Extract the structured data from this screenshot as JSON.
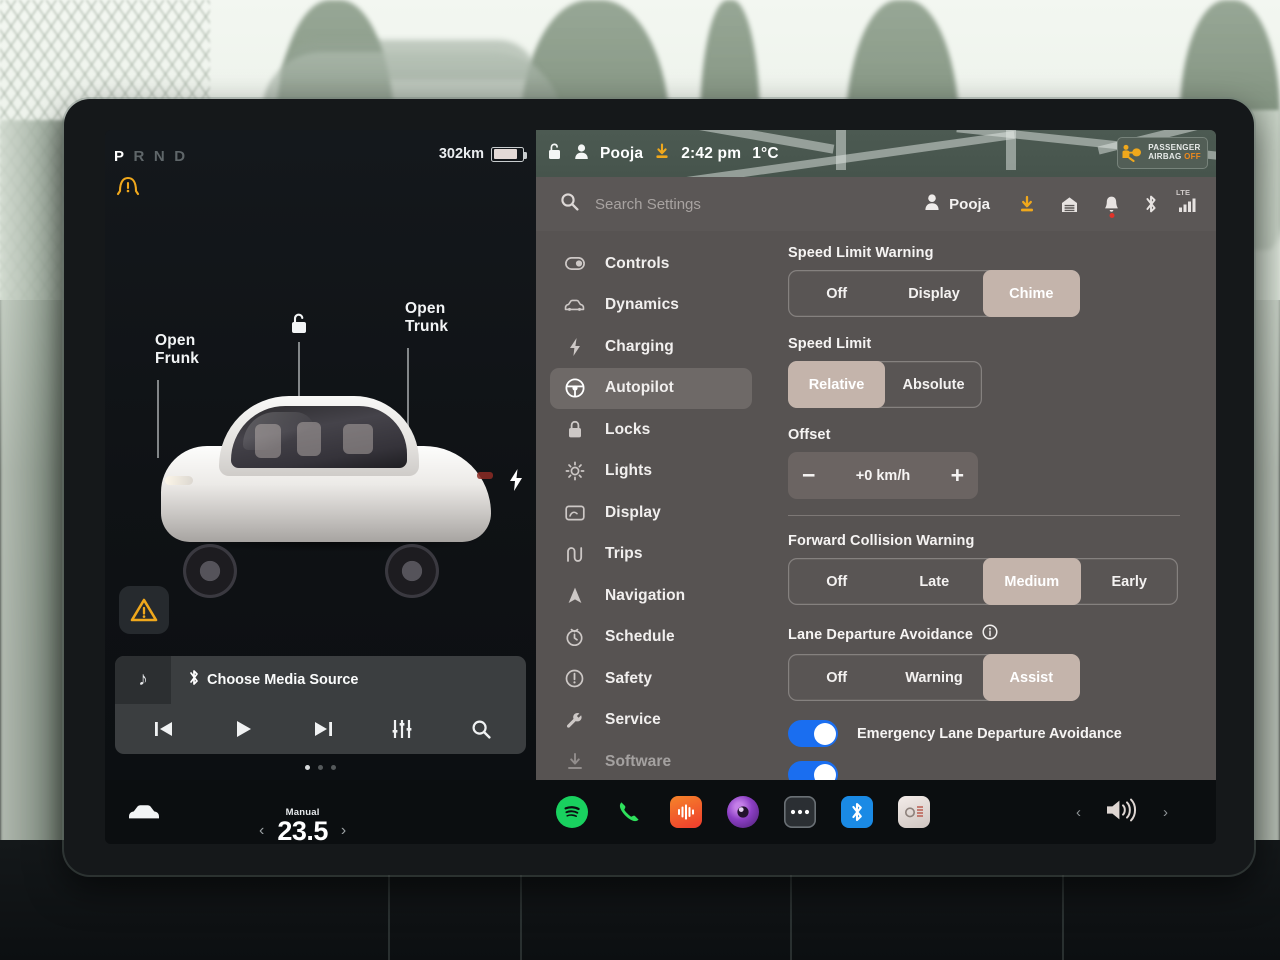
{
  "vehicle_display": {
    "gear": {
      "letters": [
        "P",
        "R",
        "N",
        "D"
      ],
      "active": "P"
    },
    "tpms_warning_icon": "tire-pressure-icon",
    "range": {
      "value": "302km",
      "battery_level_pct": 84
    },
    "callouts": {
      "frunk": "Open\nFrunk",
      "frunk_line1": "Open",
      "frunk_line2": "Frunk",
      "trunk_line1": "Open",
      "trunk_line2": "Trunk"
    },
    "unlock_icon": "unlock-icon",
    "charge_port_icon": "charge-bolt-icon",
    "alert_button_icon": "warning-triangle-icon"
  },
  "media": {
    "art_icon": "music-note-icon",
    "source_icon": "bluetooth-icon",
    "title": "Choose Media Source",
    "controls": [
      {
        "name": "previous-track",
        "icon": "skip-back-icon"
      },
      {
        "name": "play",
        "icon": "play-icon"
      },
      {
        "name": "next-track",
        "icon": "skip-forward-icon"
      },
      {
        "name": "equalizer",
        "icon": "equalizer-icon"
      },
      {
        "name": "search-media",
        "icon": "search-icon"
      }
    ],
    "page_dots": 3,
    "active_dot": 0
  },
  "status_bar": {
    "lock_icon": "unlock-icon",
    "profile_icon": "person-icon",
    "profile_name": "Pooja",
    "download_icon": "software-download-icon",
    "time": "2:42 pm",
    "temperature": "1°C",
    "airbag_badge": {
      "icon": "passenger-airbag-icon",
      "line1": "PASSENGER",
      "line2_prefix": "AIRBAG ",
      "line2_state": "OFF"
    }
  },
  "search": {
    "icon": "search-icon",
    "placeholder": "Search Settings"
  },
  "settings_status_icons": {
    "profile_name": "Pooja",
    "items": [
      {
        "name": "software-download-icon",
        "badge": false
      },
      {
        "name": "garage-door-icon",
        "badge": false
      },
      {
        "name": "notification-bell-icon",
        "badge": true
      },
      {
        "name": "bluetooth-icon",
        "badge": false
      },
      {
        "name": "lte-signal-icon",
        "label": "LTE",
        "badge": false
      }
    ]
  },
  "sidebar": {
    "items": [
      {
        "label": "Controls",
        "icon": "toggle-icon",
        "active": false,
        "dim": false
      },
      {
        "label": "Dynamics",
        "icon": "car-icon",
        "active": false,
        "dim": false
      },
      {
        "label": "Charging",
        "icon": "bolt-icon",
        "active": false,
        "dim": false
      },
      {
        "label": "Autopilot",
        "icon": "steering-wheel-icon",
        "active": true,
        "dim": false
      },
      {
        "label": "Locks",
        "icon": "lock-icon",
        "active": false,
        "dim": false
      },
      {
        "label": "Lights",
        "icon": "sun-icon",
        "active": false,
        "dim": false
      },
      {
        "label": "Display",
        "icon": "display-icon",
        "active": false,
        "dim": false
      },
      {
        "label": "Trips",
        "icon": "trips-icon",
        "active": false,
        "dim": false
      },
      {
        "label": "Navigation",
        "icon": "navigation-arrow-icon",
        "active": false,
        "dim": false
      },
      {
        "label": "Schedule",
        "icon": "clock-icon",
        "active": false,
        "dim": false
      },
      {
        "label": "Safety",
        "icon": "info-circle-icon",
        "active": false,
        "dim": false
      },
      {
        "label": "Service",
        "icon": "wrench-icon",
        "active": false,
        "dim": false
      },
      {
        "label": "Software",
        "icon": "download-icon",
        "active": false,
        "dim": true
      }
    ]
  },
  "autopilot": {
    "speed_limit_warning": {
      "title": "Speed Limit Warning",
      "options": [
        "Off",
        "Display",
        "Chime"
      ],
      "selected": "Chime"
    },
    "speed_limit": {
      "title": "Speed Limit",
      "options": [
        "Relative",
        "Absolute"
      ],
      "selected": "Relative"
    },
    "offset": {
      "title": "Offset",
      "minus": "−",
      "value": "+0 km/h",
      "plus": "+"
    },
    "forward_collision_warning": {
      "title": "Forward Collision Warning",
      "options": [
        "Off",
        "Late",
        "Medium",
        "Early"
      ],
      "selected": "Medium"
    },
    "lane_departure_avoidance": {
      "title": "Lane Departure Avoidance",
      "info_icon": "info-icon",
      "options": [
        "Off",
        "Warning",
        "Assist"
      ],
      "selected": "Assist"
    },
    "emergency_lane_departure": {
      "label": "Emergency Lane Departure Avoidance",
      "enabled": true
    }
  },
  "taskbar": {
    "car_icon": "car-icon",
    "climate": {
      "mode": "Manual",
      "temperature": "23.5",
      "left_chevron": "‹",
      "right_chevron": "›"
    },
    "apps": [
      {
        "name": "spotify-app-icon",
        "color": "#19d15f"
      },
      {
        "name": "phone-app-icon",
        "color": "#2ee05c"
      },
      {
        "name": "audio-app-icon",
        "color": "#f0502a"
      },
      {
        "name": "camera-app-icon",
        "color": "#8c3fc4"
      },
      {
        "name": "more-apps-icon",
        "color": "#2b2f33"
      },
      {
        "name": "bluetooth-app-icon",
        "color": "#1a8ae5"
      },
      {
        "name": "tuner-app-icon",
        "color": "#ded6d2"
      }
    ],
    "volume": {
      "left_chevron": "‹",
      "icon": "speaker-icon",
      "right_chevron": "›"
    }
  },
  "colors": {
    "accent_selected": "#c4b4ab",
    "toggle_on": "#1a6ef0",
    "warning_amber": "#f0a81c",
    "airbag_orange": "#f08a1c",
    "badge_red": "#e0342a",
    "panel_bg": "#575352"
  }
}
